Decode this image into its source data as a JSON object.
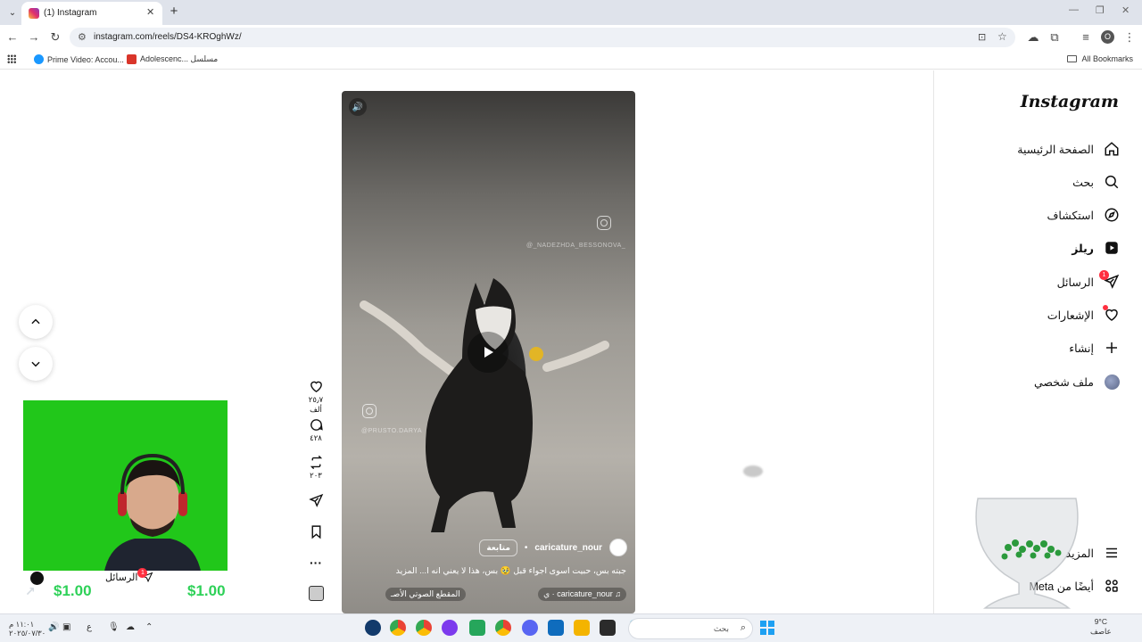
{
  "browser": {
    "tab_title": "(1) Instagram",
    "url": "instagram.com/reels/DS4-KROghWz/",
    "profile_initial": "O",
    "bookmarks": [
      {
        "label": "Prime Video: Accou..."
      },
      {
        "label": "Adolescenc... مسلسل"
      }
    ],
    "all_bookmarks": "All Bookmarks"
  },
  "instagram": {
    "logo": "Instagram",
    "nav": [
      {
        "label": "الصفحة الرئيسية"
      },
      {
        "label": "بحث"
      },
      {
        "label": "استكشاف"
      },
      {
        "label": "ريلز"
      },
      {
        "label": "الرسائل",
        "badge": "1"
      },
      {
        "label": "الإشعارات"
      },
      {
        "label": "إنشاء"
      },
      {
        "label": "ملف شخصي"
      }
    ],
    "more": "المزيد",
    "also_from_meta": "أيضًا من Meta"
  },
  "reel": {
    "author": "caricature_nour",
    "follow": "متابعة",
    "caption": "جبته بس، حبيت اسوى اجواء قبل 🥹 بس، هذا لا يعني انه ا... المزيد",
    "audio_left": "المقطع الصوتي الأصـ",
    "audio_right": "caricature_nour · ي",
    "watermark_1": "@_NADEZHDA_BESSONOVA_",
    "watermark_2": "@PRUSTO.DARYA"
  },
  "rail": {
    "likes": "٢٥٫٧ ألف",
    "comments": "٤٢٨",
    "reposts": "٢٠٣"
  },
  "webcam": {
    "messages_label": "الرسائل",
    "messages_badge": "1",
    "amount_1": "$1.00",
    "amount_2": "$1.00"
  },
  "taskbar": {
    "search_placeholder": "بحث",
    "weather_temp": "9°C",
    "weather_desc": "عاصف",
    "time": "١١:٠١ م",
    "date": "٢٠٢٥/٠٧/٣٠",
    "lang": "ع"
  }
}
